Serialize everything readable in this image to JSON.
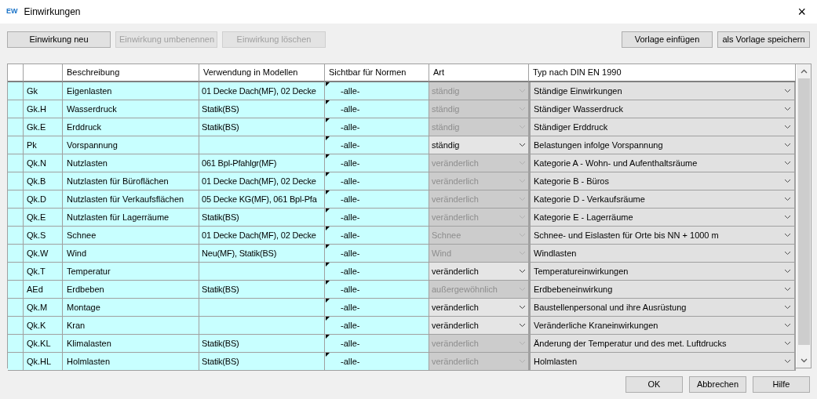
{
  "window": {
    "logo": "EW",
    "title": "Einwirkungen",
    "close": "×"
  },
  "toolbar_left": [
    {
      "label": "Einwirkung neu",
      "disabled": false
    },
    {
      "label": "Einwirkung umbenennen",
      "disabled": true
    },
    {
      "label": "Einwirkung löschen",
      "disabled": true
    }
  ],
  "toolbar_right": [
    {
      "label": "Vorlage einfügen",
      "disabled": false
    },
    {
      "label": "als Vorlage speichern",
      "disabled": false
    }
  ],
  "table": {
    "columns": [
      "Beschreibung",
      "Verwendung in Modellen",
      "Sichtbar für Normen",
      "Art",
      "Typ nach DIN EN 1990"
    ],
    "rows": [
      {
        "code": "Gk",
        "beschreibung": "Eigenlasten",
        "verwendung": "01 Decke Dach(MF), 02 Decke",
        "sichtbar": "-alle-",
        "art": "ständig",
        "art_disabled": true,
        "typ": "Ständige Einwirkungen"
      },
      {
        "code": "Gk.H",
        "beschreibung": "Wasserdruck",
        "verwendung": "Statik(BS)",
        "sichtbar": "-alle-",
        "art": "ständig",
        "art_disabled": true,
        "typ": "Ständiger Wasserdruck"
      },
      {
        "code": "Gk.E",
        "beschreibung": "Erddruck",
        "verwendung": "Statik(BS)",
        "sichtbar": "-alle-",
        "art": "ständig",
        "art_disabled": true,
        "typ": "Ständiger Erddruck"
      },
      {
        "code": "Pk",
        "beschreibung": "Vorspannung",
        "sichtbar": "-alle-",
        "art": "ständig",
        "art_disabled": false,
        "typ": "Belastungen infolge Vorspannung"
      },
      {
        "code": "Qk.N",
        "beschreibung": "Nutzlasten",
        "verwendung": "061 Bpl-Pfahlgr(MF)",
        "sichtbar": "-alle-",
        "art": "veränderlich",
        "art_disabled": true,
        "typ": "Kategorie A - Wohn- und Aufenthaltsräume"
      },
      {
        "code": "Qk.B",
        "beschreibung": "Nutzlasten für Büroflächen",
        "verwendung": "01 Decke Dach(MF), 02 Decke",
        "sichtbar": "-alle-",
        "art": "veränderlich",
        "art_disabled": true,
        "typ": "Kategorie B - Büros"
      },
      {
        "code": "Qk.D",
        "beschreibung": "Nutzlasten für Verkaufsflächen",
        "verwendung": "05 Decke KG(MF), 061 Bpl-Pfa",
        "sichtbar": "-alle-",
        "art": "veränderlich",
        "art_disabled": true,
        "typ": "Kategorie D - Verkaufsräume"
      },
      {
        "code": "Qk.E",
        "beschreibung": "Nutzlasten für Lagerräume",
        "verwendung": "Statik(BS)",
        "sichtbar": "-alle-",
        "art": "veränderlich",
        "art_disabled": true,
        "typ": "Kategorie E - Lagerräume"
      },
      {
        "code": "Qk.S",
        "beschreibung": "Schnee",
        "verwendung": "01 Decke Dach(MF), 02 Decke",
        "sichtbar": "-alle-",
        "art": "Schnee",
        "art_disabled": true,
        "typ": "Schnee- und Eislasten für Orte bis NN + 1000 m"
      },
      {
        "code": "Qk.W",
        "beschreibung": "Wind",
        "verwendung": "Neu(MF), Statik(BS)",
        "sichtbar": "-alle-",
        "art": "Wind",
        "art_disabled": true,
        "typ": "Windlasten"
      },
      {
        "code": "Qk.T",
        "beschreibung": "Temperatur",
        "sichtbar": "-alle-",
        "art": "veränderlich",
        "art_disabled": false,
        "typ": "Temperatureinwirkungen"
      },
      {
        "code": "AEd",
        "beschreibung": "Erdbeben",
        "verwendung": "Statik(BS)",
        "sichtbar": "-alle-",
        "art": "außergewöhnlich",
        "art_disabled": true,
        "typ": "Erdbebeneinwirkung"
      },
      {
        "code": "Qk.M",
        "beschreibung": "Montage",
        "sichtbar": "-alle-",
        "art": "veränderlich",
        "art_disabled": false,
        "typ": "Baustellenpersonal und ihre Ausrüstung"
      },
      {
        "code": "Qk.K",
        "beschreibung": "Kran",
        "sichtbar": "-alle-",
        "art": "veränderlich",
        "art_disabled": false,
        "typ": "Veränderliche Kraneinwirkungen"
      },
      {
        "code": "Qk.KL",
        "beschreibung": "Klimalasten",
        "verwendung": "Statik(BS)",
        "sichtbar": "-alle-",
        "art": "veränderlich",
        "art_disabled": true,
        "typ": "Änderung der Temperatur und des met. Luftdrucks"
      },
      {
        "code": "Qk.HL",
        "beschreibung": "Holmlasten",
        "verwendung": "Statik(BS)",
        "sichtbar": "-alle-",
        "art": "veränderlich",
        "art_disabled": true,
        "typ": "Holmlasten"
      }
    ]
  },
  "footer_buttons": [
    {
      "label": "OK",
      "disabled": false
    },
    {
      "label": "Abbrechen",
      "disabled": false
    },
    {
      "label": "Hilfe",
      "disabled": false
    }
  ]
}
